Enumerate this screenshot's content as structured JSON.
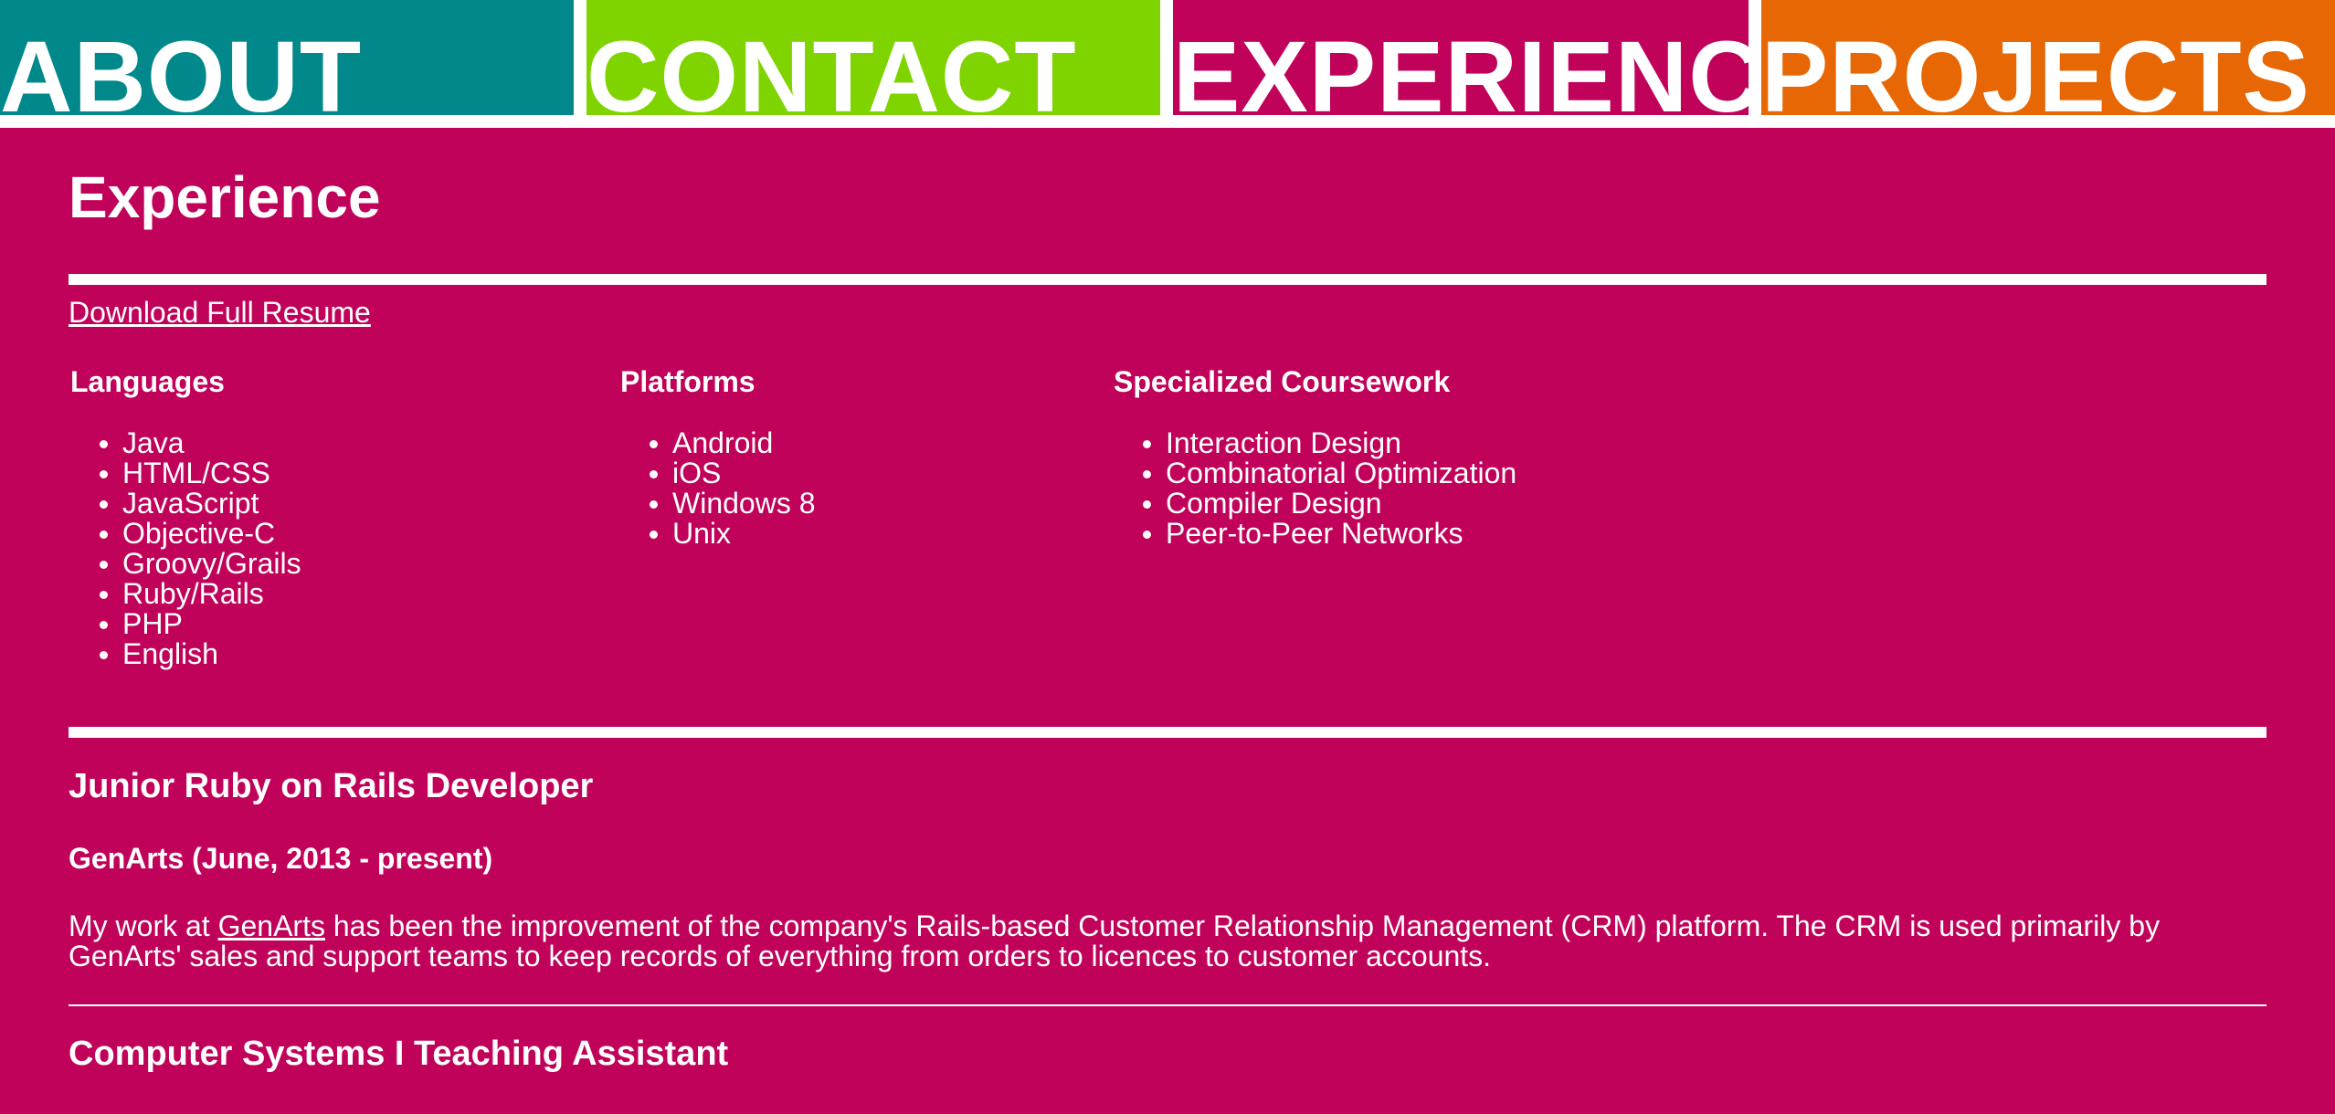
{
  "nav": {
    "tabs": [
      {
        "label": "ABOUT",
        "color": "#00888a"
      },
      {
        "label": "CONTACT",
        "color": "#7fd400"
      },
      {
        "label": "EXPERIENCE",
        "color": "#c0025a"
      },
      {
        "label": "PROJECTS",
        "color": "#e66703"
      }
    ]
  },
  "page": {
    "title": "Experience",
    "resume_link": "Download Full Resume",
    "background": "#c0025a"
  },
  "skills": {
    "languages": {
      "heading": "Languages",
      "items": [
        "Java",
        "HTML/CSS",
        "JavaScript",
        "Objective-C",
        "Groovy/Grails",
        "Ruby/Rails",
        "PHP",
        "English"
      ]
    },
    "platforms": {
      "heading": "Platforms",
      "items": [
        "Android",
        "iOS",
        "Windows 8",
        "Unix"
      ]
    },
    "coursework": {
      "heading": "Specialized Coursework",
      "items": [
        "Interaction Design",
        "Combinatorial Optimization",
        "Compiler Design",
        "Peer-to-Peer Networks"
      ]
    }
  },
  "jobs": [
    {
      "title": "Junior Ruby on Rails Developer",
      "company": "GenArts (June, 2013 - present)",
      "desc_before": "My work at ",
      "desc_link": "GenArts",
      "desc_after": " has been the improvement of the company's Rails-based Customer Relationship Management (CRM) platform. The CRM is used primarily by GenArts' sales and support teams to keep records of everything from orders to licences to customer accounts."
    },
    {
      "title": "Computer Systems I Teaching Assistant"
    }
  ]
}
